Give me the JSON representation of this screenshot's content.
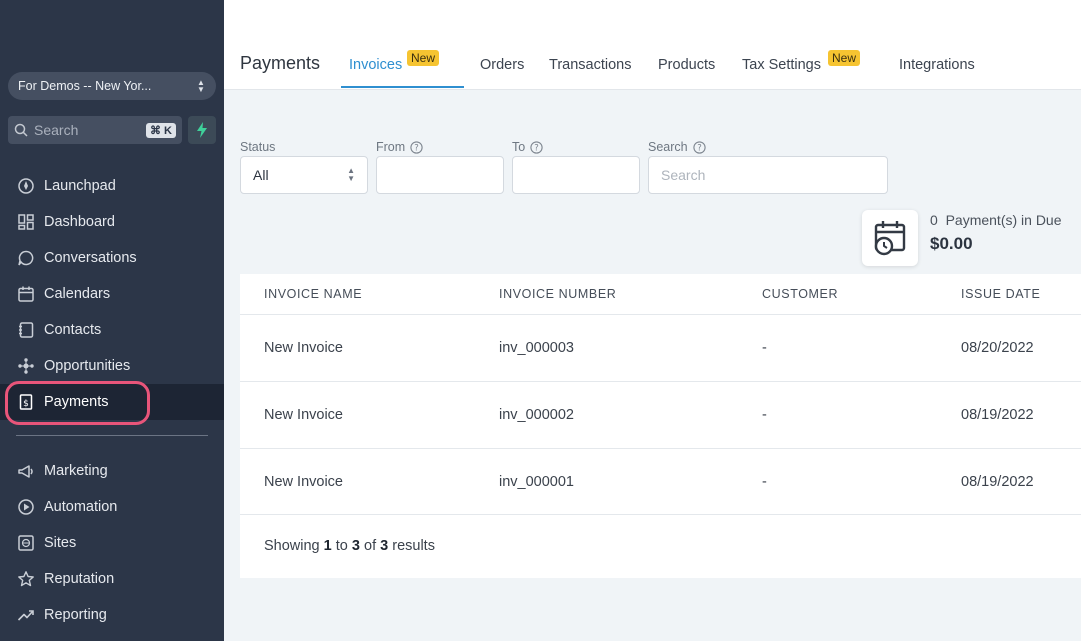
{
  "sidebar": {
    "account": "For Demos -- New Yor...",
    "search_placeholder": "Search",
    "shortcut": "⌘ K",
    "items": [
      {
        "label": "Launchpad",
        "icon": "rocket-icon"
      },
      {
        "label": "Dashboard",
        "icon": "grid-icon"
      },
      {
        "label": "Conversations",
        "icon": "chat-icon"
      },
      {
        "label": "Calendars",
        "icon": "calendar-icon"
      },
      {
        "label": "Contacts",
        "icon": "contacts-icon"
      },
      {
        "label": "Opportunities",
        "icon": "network-icon"
      },
      {
        "label": "Payments",
        "icon": "invoice-icon",
        "active": true
      },
      {
        "label": "Marketing",
        "icon": "megaphone-icon"
      },
      {
        "label": "Automation",
        "icon": "automation-icon"
      },
      {
        "label": "Sites",
        "icon": "globe-icon"
      },
      {
        "label": "Reputation",
        "icon": "star-icon"
      },
      {
        "label": "Reporting",
        "icon": "trend-icon"
      }
    ]
  },
  "header": {
    "title": "Payments",
    "tabs": [
      {
        "label": "Invoices",
        "badge": "New",
        "active": true
      },
      {
        "label": "Orders"
      },
      {
        "label": "Transactions"
      },
      {
        "label": "Products"
      },
      {
        "label": "Tax Settings",
        "badge": "New"
      },
      {
        "label": "Integrations"
      }
    ]
  },
  "filters": {
    "status_label": "Status",
    "status_value": "All",
    "from_label": "From",
    "to_label": "To",
    "search_label": "Search",
    "search_placeholder": "Search"
  },
  "due": {
    "count": "0",
    "label": "Payment(s) in Due",
    "amount": "$0.00"
  },
  "table": {
    "columns": [
      "INVOICE NAME",
      "INVOICE NUMBER",
      "CUSTOMER",
      "ISSUE DATE"
    ],
    "rows": [
      {
        "name": "New Invoice",
        "number": "inv_000003",
        "customer": "-",
        "date": "08/20/2022"
      },
      {
        "name": "New Invoice",
        "number": "inv_000002",
        "customer": "-",
        "date": "08/19/2022"
      },
      {
        "name": "New Invoice",
        "number": "inv_000001",
        "customer": "-",
        "date": "08/19/2022"
      }
    ],
    "footer": {
      "prefix": "Showing",
      "from": "1",
      "to_word": "to",
      "to": "3",
      "of_word": "of",
      "total": "3",
      "suffix": "results"
    }
  },
  "colors": {
    "accent": "#2f8fd0",
    "badge": "#f6c431",
    "highlight": "#e8557a",
    "sidebar_bg": "#2c3648"
  }
}
